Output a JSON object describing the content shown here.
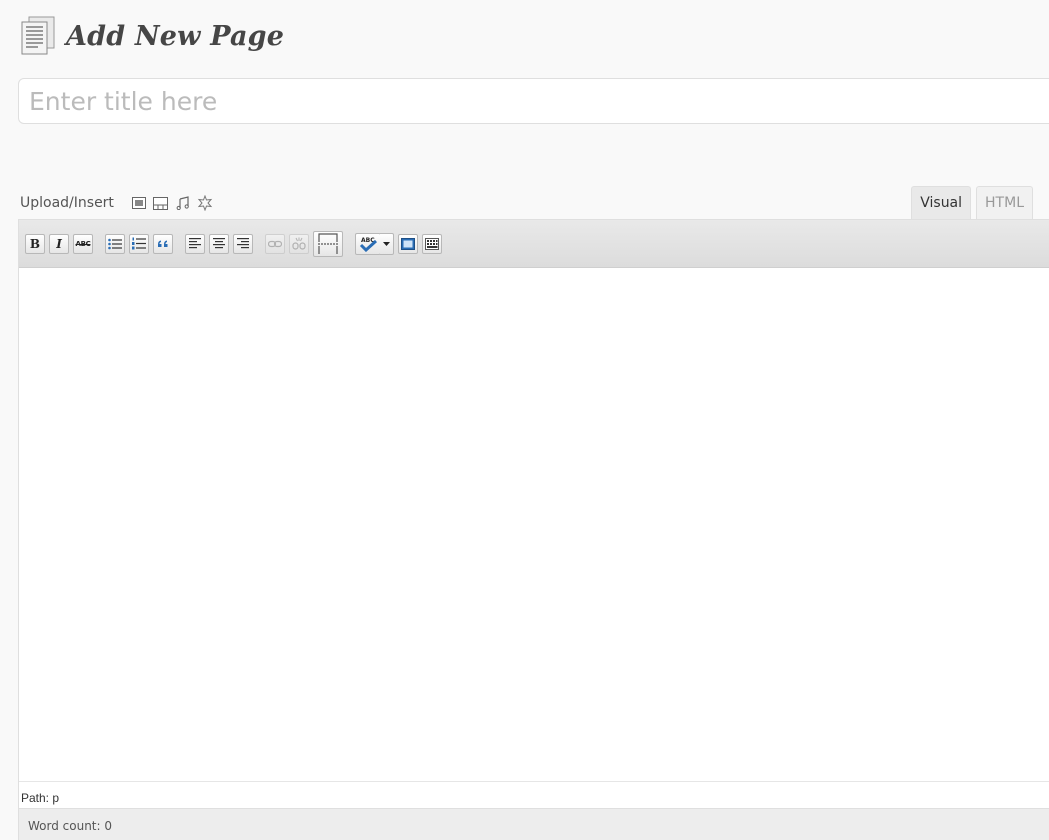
{
  "header": {
    "title": "Add New Page",
    "icon": "page-icon"
  },
  "title_field": {
    "value": "",
    "placeholder": "Enter title here"
  },
  "media": {
    "label": "Upload/Insert",
    "buttons": [
      "add-image-icon",
      "add-video-icon",
      "add-audio-icon",
      "add-media-icon"
    ]
  },
  "tabs": {
    "visual": "Visual",
    "html": "HTML",
    "active": "visual"
  },
  "toolbar": {
    "bold": "B",
    "italic": "I",
    "strikethrough": "ABC",
    "spellcheck": "ABC"
  },
  "status": {
    "path": "Path: p",
    "word_count": "Word count: 0"
  },
  "colors": {
    "background": "#f9f9f9",
    "border": "#dfdfdf",
    "toolbar": "#e9e9e9",
    "placeholder": "#bbbbbb",
    "spell_blue": "#2a6db5"
  }
}
